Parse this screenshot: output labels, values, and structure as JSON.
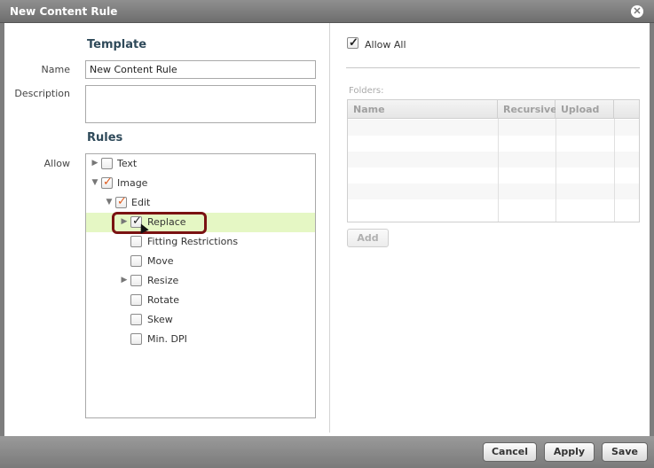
{
  "window": {
    "title": "New Content Rule",
    "close_icon": "close-icon"
  },
  "template": {
    "heading": "Template",
    "name_label": "Name",
    "name_value": "New Content Rule",
    "description_label": "Description",
    "description_value": ""
  },
  "rules": {
    "heading": "Rules",
    "allow_label": "Allow",
    "tree": [
      {
        "label": "Text",
        "checked": false,
        "expander": "collapsed"
      },
      {
        "label": "Image",
        "checked": true,
        "expander": "expanded"
      },
      {
        "label": "Edit",
        "checked": true,
        "expander": "expanded"
      },
      {
        "label": "Replace",
        "checked": true,
        "expander": "collapsed",
        "selected": true
      },
      {
        "label": "Fitting Restrictions",
        "checked": false,
        "expander": "none"
      },
      {
        "label": "Move",
        "checked": false,
        "expander": "none"
      },
      {
        "label": "Resize",
        "checked": false,
        "expander": "collapsed"
      },
      {
        "label": "Rotate",
        "checked": false,
        "expander": "none"
      },
      {
        "label": "Skew",
        "checked": false,
        "expander": "none"
      },
      {
        "label": "Min. DPI",
        "checked": false,
        "expander": "none"
      }
    ]
  },
  "folders": {
    "allow_all_label": "Allow All",
    "allow_all_checked": true,
    "folders_label": "Folders:",
    "columns": [
      "Name",
      "Recursive",
      "Upload"
    ],
    "add_label": "Add"
  },
  "footer": {
    "cancel": "Cancel",
    "apply": "Apply",
    "save": "Save"
  },
  "colors": {
    "selection": "#e5f7c4",
    "check_red": "#e05a1c",
    "highlight": "#7a1212"
  }
}
